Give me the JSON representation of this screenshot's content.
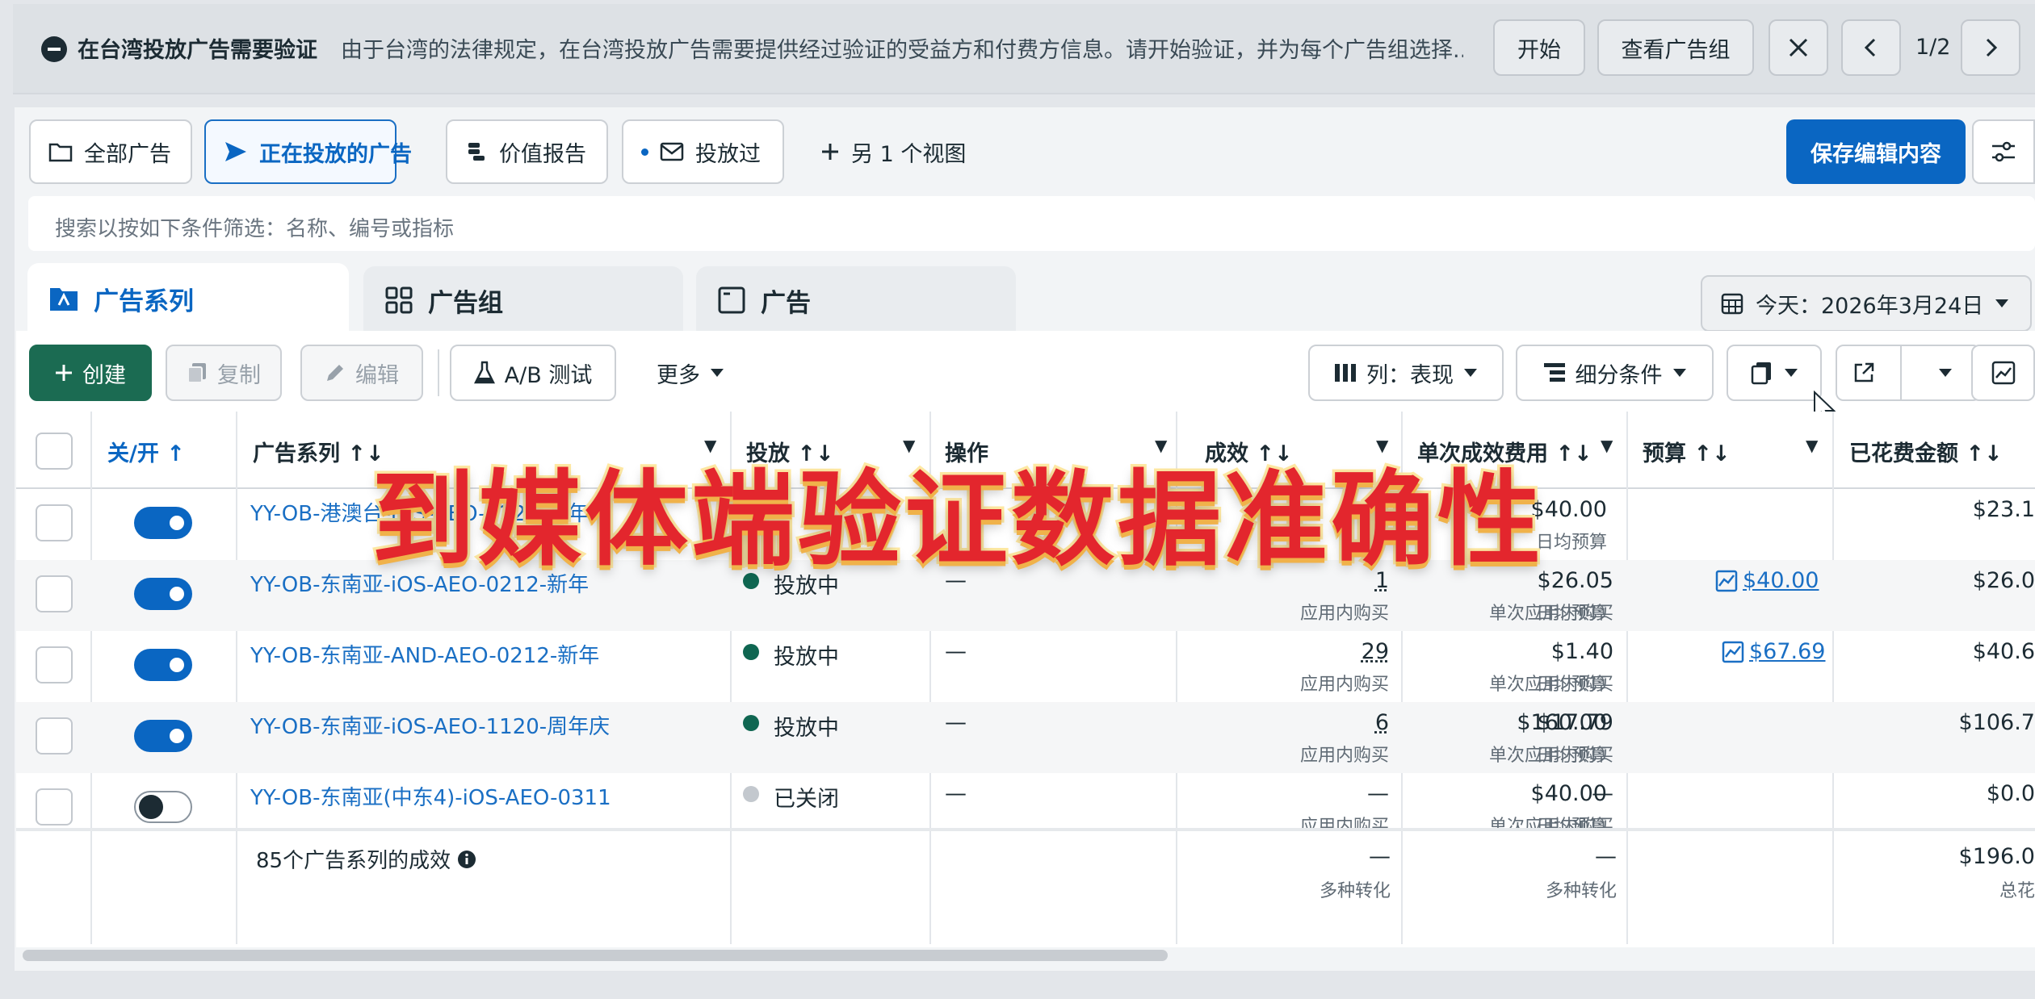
{
  "banner": {
    "title": "在台湾投放广告需要验证",
    "message": "由于台湾的法律规定，在台湾投放广告需要提供经过验证的受益方和付费方信息。请开始验证，并为每个广告组选择...",
    "start_label": "开始",
    "view_adset_label": "查看广告组",
    "page_indicator": "1/2"
  },
  "views": {
    "all_ads": "全部广告",
    "active_ads": "正在投放的广告",
    "value_report": "价值报告",
    "delivered": "投放过",
    "more_views": "另 1 个视图",
    "save_label": "保存编辑内容"
  },
  "search": {
    "placeholder": "搜索以按如下条件筛选：名称、编号或指标"
  },
  "tabs": {
    "campaigns": "广告系列",
    "adsets": "广告组",
    "ads": "广告"
  },
  "date": {
    "label": "今天：2026年3月24日"
  },
  "toolbar": {
    "create": "创建",
    "duplicate": "复制",
    "edit": "编辑",
    "ab_test": "A/B 测试",
    "more": "更多",
    "columns": "列：表现",
    "breakdown": "细分条件"
  },
  "table": {
    "headers": {
      "toggle": "关/开",
      "campaign": "广告系列",
      "delivery": "投放",
      "actions": "操作",
      "results": "成效",
      "cost_per_result": "单次成效费用",
      "budget": "预算",
      "amount_spent": "已花费金额"
    },
    "rows": [
      {
        "name": "YY-OB-港澳台-iOS-AEO-0224-新年",
        "on": true,
        "status": "",
        "action": "",
        "results": "",
        "results_sub": "应用内购买",
        "cpr": "",
        "cpr_sub": "单次应用内购买",
        "budget": "$40.00",
        "budget_sub": "日均预算",
        "spent": "$23.1"
      },
      {
        "name": "YY-OB-东南亚-iOS-AEO-0212-新年",
        "on": true,
        "status": "投放中",
        "action": "—",
        "results": "1",
        "results_sub": "应用内购买",
        "cpr": "$26.05",
        "cpr_sub": "单次应用内购买",
        "budget": "$40.00",
        "budget_sub": "日均预算",
        "spent": "$26.0"
      },
      {
        "name": "YY-OB-东南亚-AND-AEO-0212-新年",
        "on": true,
        "status": "投放中",
        "action": "—",
        "results": "29",
        "results_sub": "应用内购买",
        "cpr": "$1.40",
        "cpr_sub": "单次应用内购买",
        "budget": "$67.69",
        "budget_sub": "日均预算",
        "spent": "$40.6"
      },
      {
        "name": "YY-OB-东南亚-iOS-AEO-1120-周年庆",
        "on": true,
        "status": "投放中",
        "action": "—",
        "results": "6",
        "results_sub": "应用内购买",
        "cpr": "$17.79",
        "cpr_sub": "单次应用内购买",
        "budget": "$160.00",
        "budget_sub": "日均预算",
        "spent": "$106.7"
      },
      {
        "name": "YY-OB-东南亚(中东4)-iOS-AEO-0311",
        "on": false,
        "status": "已关闭",
        "action": "—",
        "results": "—",
        "results_sub": "应用内购买",
        "cpr": "—",
        "cpr_sub": "单次应用内购买",
        "budget": "$40.00",
        "budget_sub": "日均预算",
        "spent": "$0.0"
      }
    ],
    "summary": {
      "label": "85个广告系列的成效",
      "results": "—",
      "results_sub": "多种转化",
      "cpr": "—",
      "cpr_sub": "多种转化",
      "spent": "$196.0",
      "spent_sub": "总花"
    }
  },
  "overlay_caption": "到媒体端验证数据准确性",
  "colors": {
    "brand_blue": "#0a66c2",
    "create_green": "#1b6b52",
    "active_dot": "#0f6651",
    "link": "#1a6fc4"
  }
}
